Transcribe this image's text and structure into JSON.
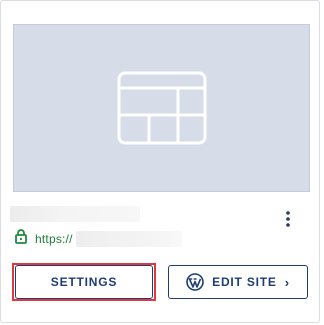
{
  "card": {
    "thumbnail_icon": "layout-template-icon",
    "site_url_prefix": "https://",
    "actions": {
      "settings_label": "SETTINGS",
      "edit_site_label": "EDIT SITE",
      "edit_site_chevron": "›"
    }
  },
  "colors": {
    "thumbnail_bg": "#d6dde8",
    "button_text": "#1f3d75",
    "url_text": "#1d7d3a",
    "lock_icon": "#1d8a3c",
    "highlight": "#e0393e"
  }
}
